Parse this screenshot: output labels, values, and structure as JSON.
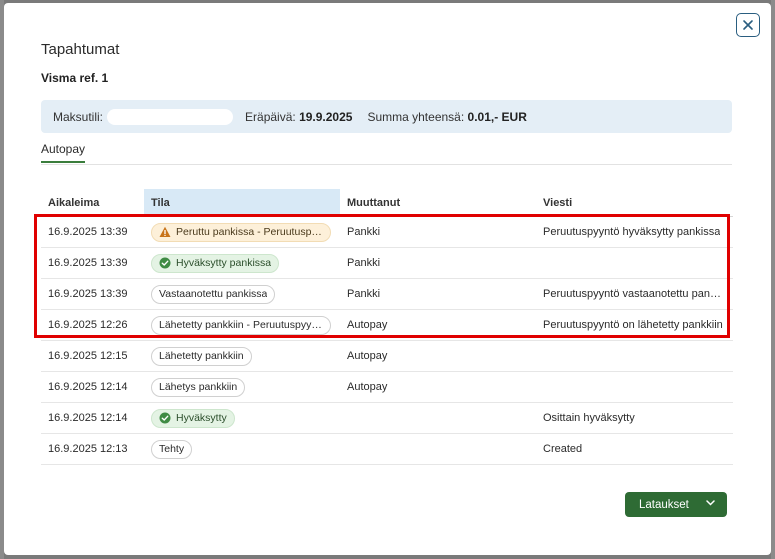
{
  "dialog": {
    "title": "Tapahtumat",
    "subtitle": "Visma ref. 1",
    "close_icon": "close-icon"
  },
  "info": {
    "account_label": "Maksutili:",
    "account_value": "",
    "due_label": "Eräpäivä:",
    "due_value": "19.9.2025",
    "total_label": "Summa yhteensä:",
    "total_value": "0.01,- EUR"
  },
  "tabs": [
    {
      "label": "Autopay",
      "active": true
    }
  ],
  "table": {
    "columns": [
      "Aikaleima",
      "Tila",
      "Muuttanut",
      "Viesti"
    ],
    "rows": [
      {
        "time": "16.9.2025 13:39",
        "status": "Peruttu pankissa - Peruutuspyyntö hyväksytty",
        "status_type": "warning",
        "changed_by": "Pankki",
        "message": "Peruutuspyyntö hyväksytty pankissa"
      },
      {
        "time": "16.9.2025 13:39",
        "status": "Hyväksytty pankissa",
        "status_type": "success",
        "changed_by": "Pankki",
        "message": ""
      },
      {
        "time": "16.9.2025 13:39",
        "status": "Vastaanotettu pankissa",
        "status_type": "neutral",
        "changed_by": "Pankki",
        "message": "Peruutuspyyntö vastaanotettu pankissa"
      },
      {
        "time": "16.9.2025 12:26",
        "status": "Lähetetty pankkiin - Peruutuspyyntö",
        "status_type": "neutral",
        "changed_by": "Autopay",
        "message": "Peruutuspyyntö on lähetetty pankkiin"
      },
      {
        "time": "16.9.2025 12:15",
        "status": "Lähetetty pankkiin",
        "status_type": "neutral",
        "changed_by": "Autopay",
        "message": ""
      },
      {
        "time": "16.9.2025 12:14",
        "status": "Lähetys pankkiin",
        "status_type": "neutral",
        "changed_by": "Autopay",
        "message": ""
      },
      {
        "time": "16.9.2025 12:14",
        "status": "Hyväksytty",
        "status_type": "success",
        "changed_by": "",
        "message": "Osittain hyväksytty"
      },
      {
        "time": "16.9.2025 12:13",
        "status": "Tehty",
        "status_type": "neutral",
        "changed_by": "",
        "message": "Created"
      }
    ]
  },
  "footer": {
    "downloads_label": "Lataukset",
    "chevron_icon": "chevron-down-icon"
  },
  "colors": {
    "accent_green": "#2e6b34",
    "info_bar_bg": "#e4eef6",
    "warning_bg": "#fdf0d9",
    "success_bg": "#e4f3e4",
    "highlight_red": "#e00000"
  }
}
